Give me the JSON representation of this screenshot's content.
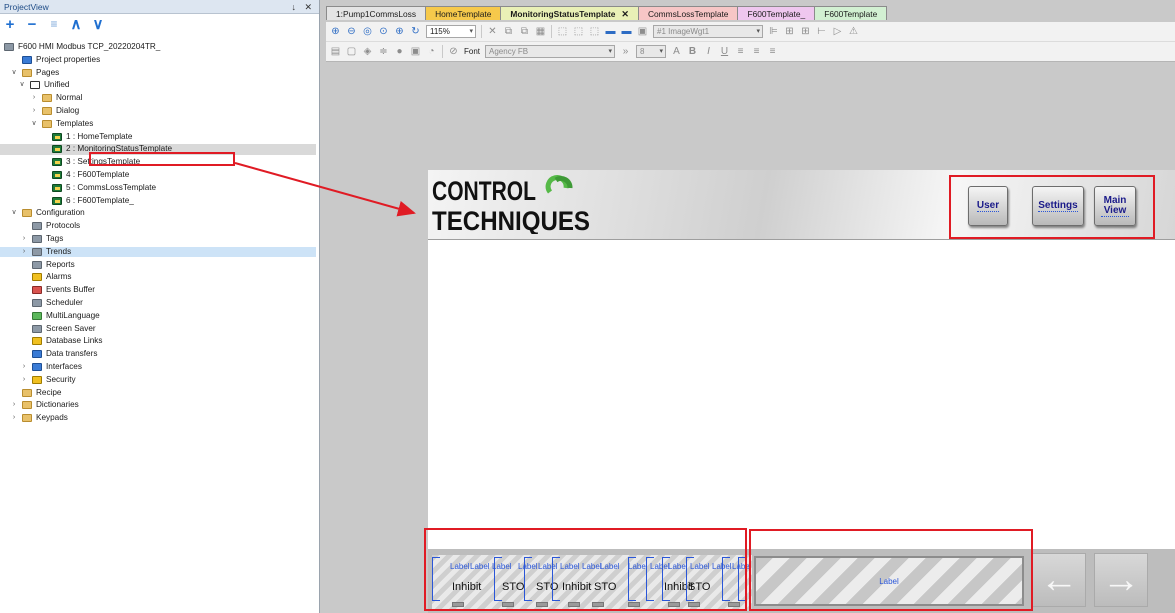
{
  "project_view": {
    "title": "ProjectView",
    "header_buttons": "↓ ✕",
    "toolbar": [
      "+",
      "−",
      "≡",
      "∧",
      "∨"
    ],
    "tree": [
      {
        "label": "F600 HMI Modbus TCP_20220204TR_",
        "icon": "project-icon",
        "twisty": "∨"
      },
      {
        "label": "Project properties",
        "icon": "properties-icon",
        "twisty": ""
      },
      {
        "label": "Pages",
        "icon": "folder-icon",
        "twisty": "∨"
      },
      {
        "label": "Unified",
        "icon": "unified-icon",
        "twisty": "∨"
      },
      {
        "label": "Normal",
        "icon": "folder-icon",
        "twisty": "›"
      },
      {
        "label": "Dialog",
        "icon": "folder-icon",
        "twisty": "›"
      },
      {
        "label": "Templates",
        "icon": "folder-icon",
        "twisty": "∨"
      },
      {
        "label": "1 : HomeTemplate",
        "icon": "page-icon",
        "twisty": ""
      },
      {
        "label": "2 : MonitoringStatusTemplate",
        "icon": "page-icon",
        "twisty": ""
      },
      {
        "label": "3 : SettingsTemplate",
        "icon": "page-icon",
        "twisty": ""
      },
      {
        "label": "4 : F600Template",
        "icon": "page-icon",
        "twisty": ""
      },
      {
        "label": "5 : CommsLossTemplate",
        "icon": "page-icon",
        "twisty": ""
      },
      {
        "label": "6 : F600Template_",
        "icon": "page-icon",
        "twisty": ""
      },
      {
        "label": "Configuration",
        "icon": "folder-icon",
        "twisty": "∨"
      },
      {
        "label": "Protocols",
        "icon": "protocols-icon",
        "twisty": ""
      },
      {
        "label": "Tags",
        "icon": "tags-icon",
        "twisty": "›"
      },
      {
        "label": "Trends",
        "icon": "trends-icon",
        "twisty": "›"
      },
      {
        "label": "Reports",
        "icon": "reports-icon",
        "twisty": ""
      },
      {
        "label": "Alarms",
        "icon": "alarms-icon",
        "twisty": ""
      },
      {
        "label": "Events Buffer",
        "icon": "events-icon",
        "twisty": ""
      },
      {
        "label": "Scheduler",
        "icon": "scheduler-icon",
        "twisty": ""
      },
      {
        "label": "MultiLanguage",
        "icon": "language-icon",
        "twisty": ""
      },
      {
        "label": "Screen Saver",
        "icon": "screensaver-icon",
        "twisty": ""
      },
      {
        "label": "Database Links",
        "icon": "database-icon",
        "twisty": ""
      },
      {
        "label": "Data transfers",
        "icon": "transfer-icon",
        "twisty": ""
      },
      {
        "label": "Interfaces",
        "icon": "interfaces-icon",
        "twisty": "›"
      },
      {
        "label": "Security",
        "icon": "lock-icon",
        "twisty": "›"
      },
      {
        "label": "Recipe",
        "icon": "folder-icon",
        "twisty": ""
      },
      {
        "label": "Dictionaries",
        "icon": "folder-icon",
        "twisty": "›"
      },
      {
        "label": "Keypads",
        "icon": "folder-icon",
        "twisty": "›"
      }
    ]
  },
  "tabs": [
    {
      "label": "1:Pump1CommsLoss",
      "color": "#e4e4e4",
      "active": false
    },
    {
      "label": "HomeTemplate",
      "color": "#f6c94b",
      "active": false
    },
    {
      "label": "MonitoringStatusTemplate",
      "color": "#e9f0b6",
      "active": true,
      "close": "✕"
    },
    {
      "label": "CommsLossTemplate",
      "color": "#f7c6c6",
      "active": false
    },
    {
      "label": "F600Template_",
      "color": "#efc7ef",
      "active": false
    },
    {
      "label": "F600Template",
      "color": "#d2f0d2",
      "active": false
    }
  ],
  "toolbar1": {
    "zoom": "115%",
    "widget": "#1 ImageWgt1"
  },
  "toolbar2": {
    "font_label": "Font",
    "font_value": "Agency FB",
    "size_value": "8"
  },
  "template": {
    "logo_line1": "CONTROL",
    "logo_line2": "TECHNIQUES",
    "buttons": [
      {
        "label": "User"
      },
      {
        "label": "Settings"
      },
      {
        "label": "Main View"
      }
    ],
    "mini_labels": {
      "label": "Label",
      "texts": [
        "Inhibit",
        "STO",
        "STO",
        "Inhibit",
        "STO",
        "Inhibit",
        "STO"
      ]
    },
    "big_label": "Label",
    "left_arrow": "←",
    "right_arrow": "→"
  },
  "colors": {
    "highlight": "#e01b24",
    "selection": "#d9d9d9"
  }
}
